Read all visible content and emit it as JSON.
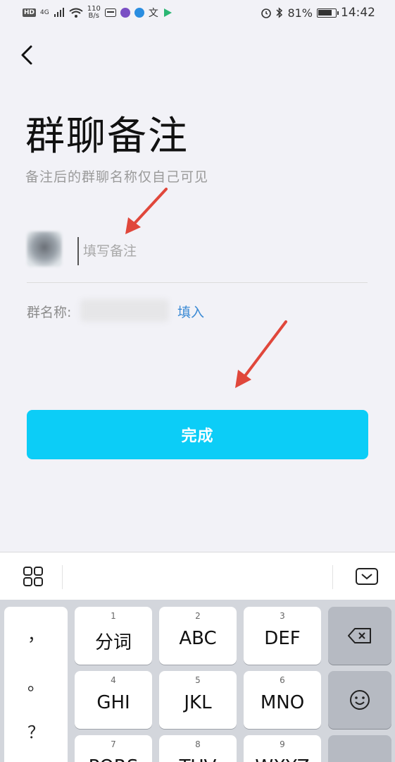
{
  "status_bar": {
    "hd": "HD",
    "network_gen": "4G",
    "net_speed_value": "110",
    "net_speed_unit": "B/s",
    "battery_pct": "81%",
    "time": "14:42"
  },
  "page": {
    "title": "群聊备注",
    "subtitle": "备注后的群聊名称仅自己可见"
  },
  "remark_input": {
    "placeholder": "填写备注",
    "value": ""
  },
  "group_name": {
    "label": "群名称:",
    "fill_in_label": "填入"
  },
  "done_button": {
    "label": "完成",
    "color": "#0ccdf7"
  },
  "keyboard": {
    "punctuation": [
      "，",
      "。",
      "？",
      "！"
    ],
    "keys": [
      {
        "num": "1",
        "label": "分词"
      },
      {
        "num": "2",
        "label": "ABC"
      },
      {
        "num": "3",
        "label": "DEF"
      },
      {
        "num": "4",
        "label": "GHI"
      },
      {
        "num": "5",
        "label": "JKL"
      },
      {
        "num": "6",
        "label": "MNO"
      },
      {
        "num": "7",
        "label": "PQRS"
      },
      {
        "num": "8",
        "label": "TUV"
      },
      {
        "num": "9",
        "label": "WXYZ"
      }
    ],
    "icons": {
      "layout": "grid-icon",
      "hide": "keyboard-hide-icon",
      "delete": "backspace-icon",
      "emoji": "emoji-icon"
    }
  },
  "annotation_color": "#e0473b"
}
